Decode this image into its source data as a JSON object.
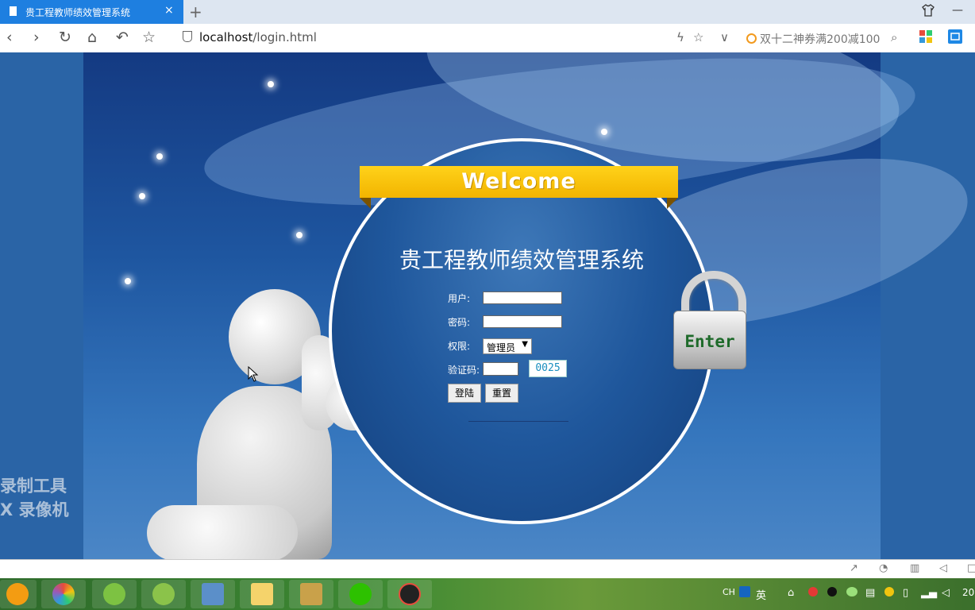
{
  "browser": {
    "tab_title": "贵工程教师绩效管理系统",
    "tab_close": "×",
    "new_tab": "+",
    "url_host": "localhost",
    "url_path": "/login.html",
    "search_text": "双十二神券满200减100",
    "window_min": "—"
  },
  "login": {
    "welcome": "Welcome",
    "title": "贵工程教师绩效管理系统",
    "user_label": "用户:",
    "password_label": "密码:",
    "role_label": "权限:",
    "role_value": "管理员",
    "captcha_label": "验证码:",
    "captcha_code": "0025",
    "login_button": "登陆",
    "reset_button": "重置",
    "enter_label": "Enter"
  },
  "watermark": {
    "line1": "录制工具",
    "line2": "X 录像机"
  },
  "taskbar": {
    "ime_lang": "CH",
    "ime_mode": "英",
    "clock": "20"
  },
  "colors": {
    "tab_active": "#1e7fe0",
    "banner": "#f5bd00",
    "captcha_text": "#1a8fbf"
  }
}
